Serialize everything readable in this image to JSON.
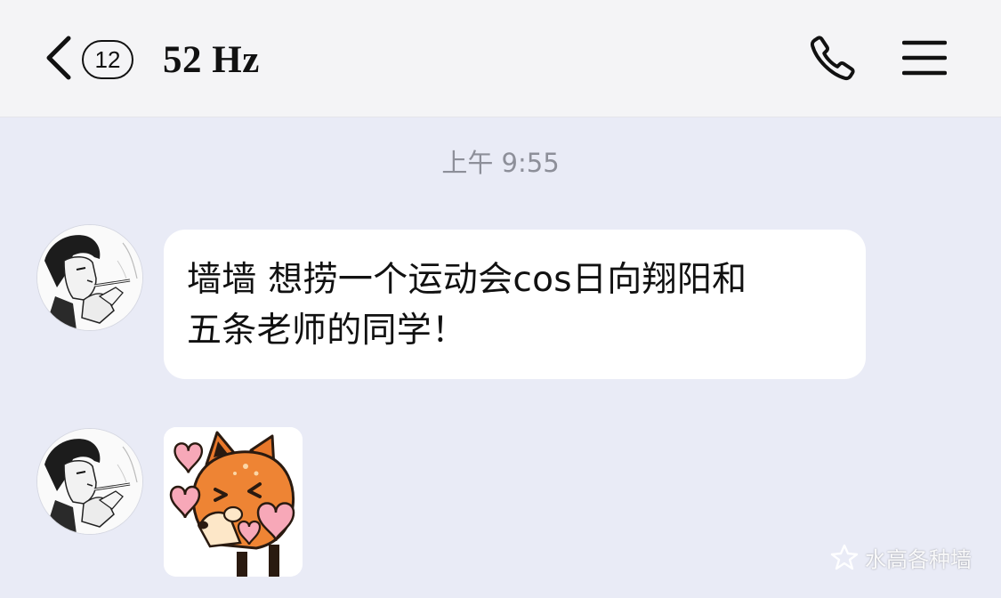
{
  "header": {
    "unread_count": "12",
    "title": "52 Hz",
    "icons": {
      "back": "chevron-left-icon",
      "call": "phone-icon",
      "menu": "hamburger-menu-icon"
    }
  },
  "chat": {
    "timestamp": "上午 9:55",
    "messages": [
      {
        "type": "text",
        "lines": [
          "墙墙 想捞一个运动会cos日向翔阳和",
          "五条老师的同学！"
        ]
      },
      {
        "type": "sticker",
        "sticker": "fox-with-hearts-sticker"
      }
    ]
  },
  "watermark": {
    "text": "水高各种墙"
  },
  "colors": {
    "chat_background": "#e9ebf6",
    "header_background": "#f4f4f6",
    "bubble_background": "#ffffff",
    "timestamp": "#8d8f99"
  }
}
